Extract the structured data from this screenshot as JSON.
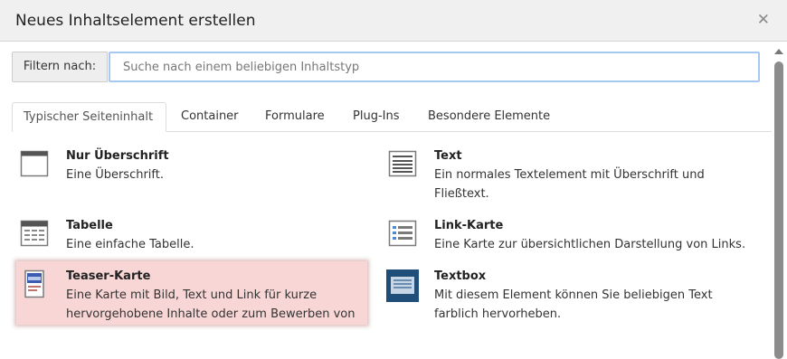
{
  "dialog": {
    "title": "Neues Inhaltselement erstellen"
  },
  "filter": {
    "label": "Filtern nach:",
    "placeholder": "Suche nach einem beliebigen Inhaltstyp"
  },
  "tabs": [
    {
      "label": "Typischer Seiteninhalt",
      "active": true
    },
    {
      "label": "Container"
    },
    {
      "label": "Formulare"
    },
    {
      "label": "Plug-Ins"
    },
    {
      "label": "Besondere Elemente"
    }
  ],
  "items": [
    {
      "title": "Nur Überschrift",
      "description": "Eine Überschrift.",
      "icon": "header-only-icon"
    },
    {
      "title": "Text",
      "description": "Ein normales Textelement mit Überschrift und Fließtext.",
      "icon": "text-icon"
    },
    {
      "title": "Tabelle",
      "description": "Eine einfache Tabelle.",
      "icon": "table-icon"
    },
    {
      "title": "Link-Karte",
      "description": "Eine Karte zur übersichtlichen Darstellung von Links.",
      "icon": "link-card-icon"
    },
    {
      "title": "Teaser-Karte",
      "description": "Eine Karte mit Bild, Text und Link für kurze hervorgehobene Inhalte oder zum Bewerben von",
      "icon": "teaser-card-icon",
      "selected": true
    },
    {
      "title": "Textbox",
      "description": "Mit diesem Element können Sie beliebigen Text farblich hervorheben.",
      "icon": "textbox-icon"
    }
  ],
  "colors": {
    "selected_bg": "#f9d6d6",
    "accent_blue": "#1f4e79",
    "focus_border": "#a8c9ef"
  }
}
